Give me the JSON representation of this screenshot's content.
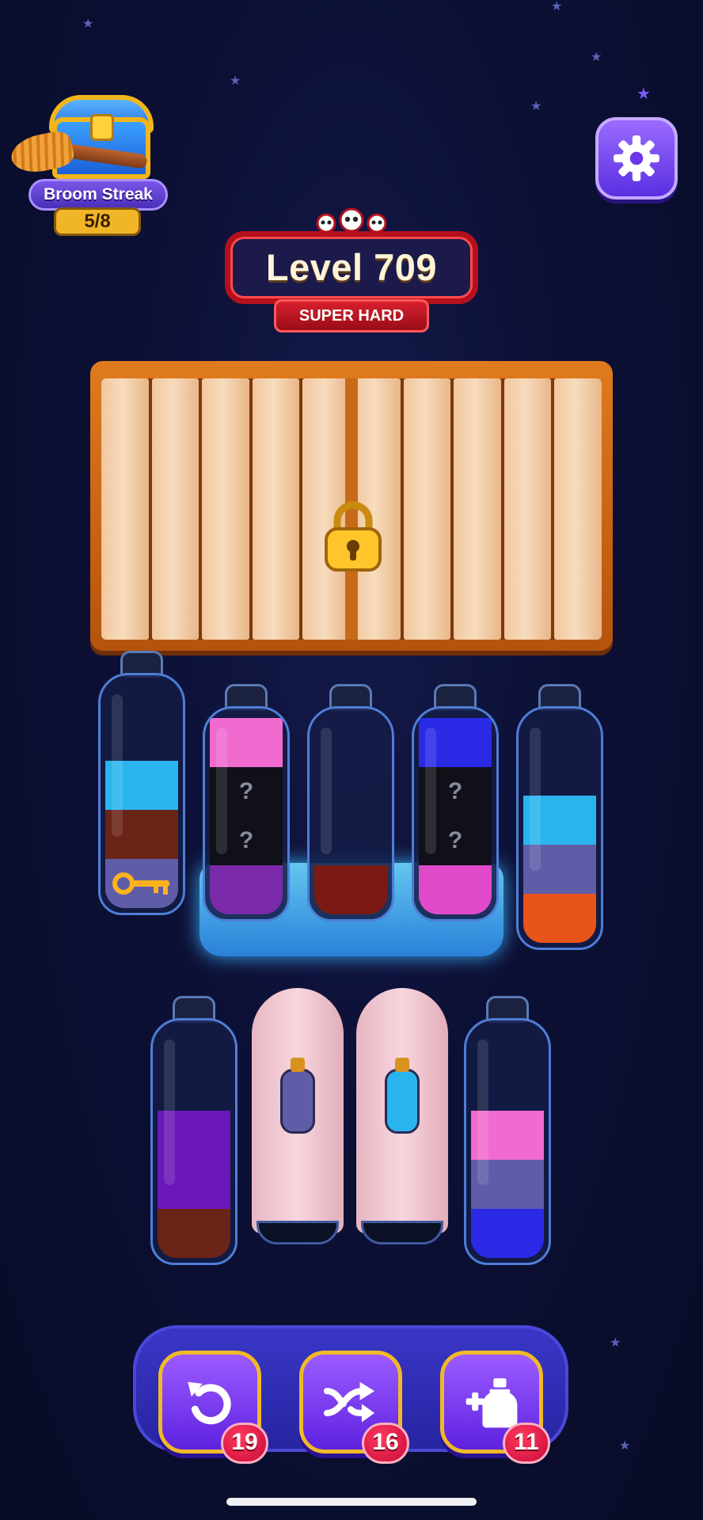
{
  "streak": {
    "title": "Broom Streak",
    "progress": "5/8"
  },
  "level": {
    "title": "Level 709",
    "difficulty": "SUPER HARD"
  },
  "icons": {
    "settings": "gear-icon",
    "undo": "undo-icon",
    "shuffle": "shuffle-icon",
    "add_bottle": "add-bottle-icon",
    "lock": "padlock-icon",
    "key": "key-icon",
    "difficulty": "skull-icon"
  },
  "tools": [
    {
      "name": "undo",
      "count": "19"
    },
    {
      "name": "shuffle",
      "count": "16"
    },
    {
      "name": "add-bottle",
      "count": "11"
    }
  ],
  "colors": {
    "light_blue": "#2ab4ee",
    "brown": "#6a2418",
    "slate": "#5f5ca8",
    "pink": "#f06ad0",
    "dark_red": "#7a1a12",
    "blue": "#2a2ae6",
    "orange": "#e8541a",
    "purple": "#6a18b8"
  },
  "bottles": [
    {
      "id": "b1",
      "layers": [
        {
          "color": "#5f5ca8"
        },
        {
          "color": "#6a2418"
        },
        {
          "color": "#2ab4ee"
        }
      ],
      "has_key": true
    },
    {
      "id": "b2",
      "frozen": true,
      "layers": [
        {
          "color": "#7a2aa8"
        },
        {
          "mystery": true,
          "label": "?"
        },
        {
          "mystery": true,
          "label": "?"
        },
        {
          "color": "#f06ad0"
        }
      ]
    },
    {
      "id": "b3",
      "frozen": true,
      "layers": [
        {
          "color": "#7a1a12"
        }
      ]
    },
    {
      "id": "b4",
      "frozen": true,
      "layers": [
        {
          "color": "#e04ac8"
        },
        {
          "mystery": true,
          "label": "?"
        },
        {
          "mystery": true,
          "label": "?"
        },
        {
          "color": "#2a2ae6"
        }
      ]
    },
    {
      "id": "b5",
      "layers": [
        {
          "color": "#e8541a"
        },
        {
          "color": "#5f5ca8"
        },
        {
          "color": "#2ab4ee"
        }
      ]
    },
    {
      "id": "b6",
      "layers": [
        {
          "color": "#6a2418"
        },
        {
          "color": "#6a18b8"
        },
        {
          "color": "#6a18b8"
        }
      ]
    },
    {
      "id": "b7",
      "covered": true,
      "hint_color": "#5f5ca8"
    },
    {
      "id": "b8",
      "covered": true,
      "hint_color": "#2ab4ee"
    },
    {
      "id": "b9",
      "layers": [
        {
          "color": "#2a2ae6"
        },
        {
          "color": "#5f5ca8"
        },
        {
          "color": "#f06ad0"
        }
      ]
    }
  ]
}
